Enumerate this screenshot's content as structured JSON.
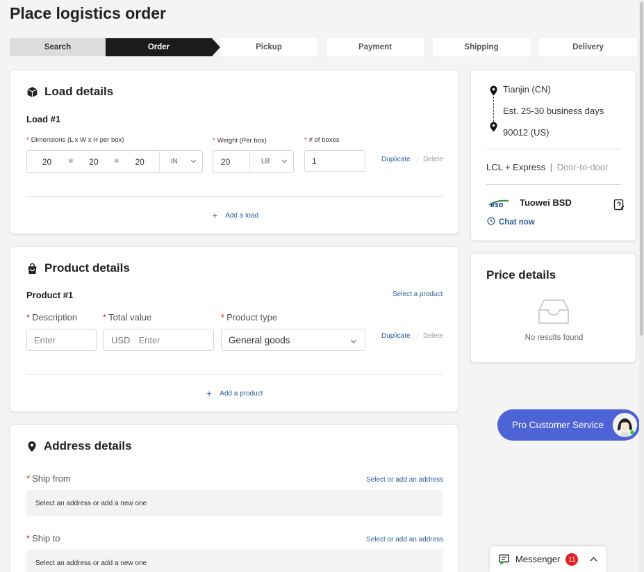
{
  "page": {
    "title": "Place logistics order"
  },
  "steps": [
    "Search",
    "Order",
    "Pickup",
    "Payment",
    "Shipping",
    "Delivery"
  ],
  "load": {
    "title": "Load details",
    "item_title": "Load #1",
    "dimensions_label": "Dimensions (L x W x H per box)",
    "weight_label": "Weight (Per box)",
    "boxes_label": "# of boxes",
    "length": "20",
    "width": "20",
    "height": "20",
    "dim_unit": "IN",
    "weight": "20",
    "weight_unit": "LB",
    "boxes": "1",
    "duplicate": "Duplicate",
    "delete": "Delete",
    "add": "Add a load"
  },
  "product": {
    "title": "Product details",
    "item_title": "Product #1",
    "select": "Select a product",
    "desc_label": "Description",
    "desc_placeholder": "Enter",
    "value_label": "Total value",
    "currency": "USD",
    "value_placeholder": "Enter",
    "type_label": "Product type",
    "type_value": "General goods",
    "duplicate": "Duplicate",
    "delete": "Delete",
    "add": "Add a product"
  },
  "address": {
    "title": "Address details",
    "from_label": "Ship from",
    "from_link": "Select or add an address",
    "from_placeholder": "Select an address or add a new one",
    "to_label": "Ship to",
    "to_link": "Select or add an address",
    "to_placeholder": "Select an address or add a new one"
  },
  "route": {
    "origin": "Tianjin (CN)",
    "transit": "Est. 25-30 business days",
    "destination": "90012 (US)",
    "service": "LCL + Express",
    "service_sep": "|",
    "service_type": "Door-to-door",
    "logo_text": "BSD",
    "supplier": "Tuowei BSD",
    "chat": "Chat now"
  },
  "price": {
    "title": "Price details",
    "empty": "No results found"
  },
  "support": {
    "label": "Pro Customer Service"
  },
  "messenger": {
    "label": "Messenger",
    "count": "11"
  },
  "colors": {
    "accent": "#4d63d6",
    "link": "#2a5d9a",
    "required": "#e02020",
    "step_active": "#1b1b1b"
  }
}
